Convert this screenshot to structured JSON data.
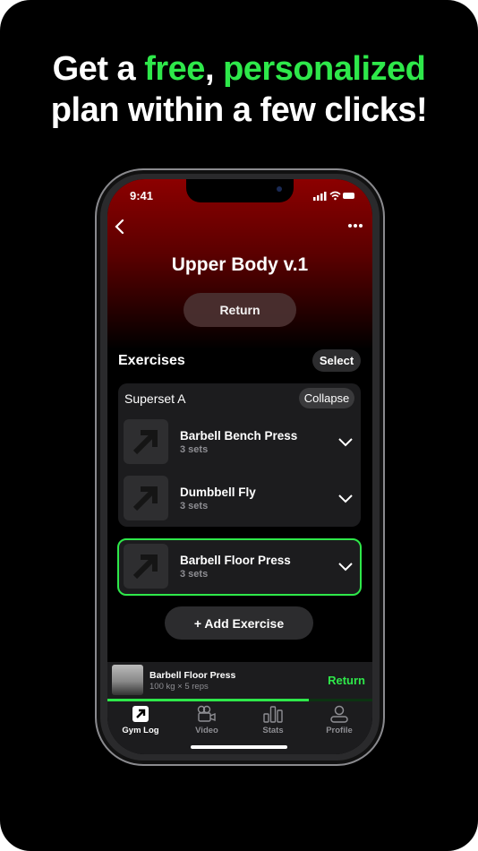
{
  "headline": {
    "line1_a": "Get a ",
    "line1_b": "free",
    ",": ",",
    "line1_c": "personalized",
    "line2": "plan within a few clicks!"
  },
  "colors": {
    "accent": "#2ee84a",
    "hero": "#8c0000"
  },
  "status": {
    "time": "9:41"
  },
  "header": {
    "back_icon": "chevron-left-icon",
    "more_icon": "ellipsis-icon",
    "title": "Upper Body v.1",
    "return_label": "Return"
  },
  "exercises": {
    "title": "Exercises",
    "select_label": "Select",
    "superset": {
      "name": "Superset A",
      "collapse_label": "Collapse",
      "items": [
        {
          "name": "Barbell Bench Press",
          "sets": "3 sets"
        },
        {
          "name": "Dumbbell Fly",
          "sets": "3 sets"
        }
      ]
    },
    "selected": {
      "name": "Barbell Floor Press",
      "sets": "3 sets"
    },
    "add_label": "+ Add Exercise"
  },
  "mini_player": {
    "name": "Barbell Floor Press",
    "detail": "100 kg × 5 reps",
    "action": "Return",
    "progress_percent": 76
  },
  "tabs": [
    {
      "label": "Gym Log",
      "icon": "arrow-up-right-icon",
      "active": true
    },
    {
      "label": "Video",
      "icon": "video-camera-icon"
    },
    {
      "label": "Stats",
      "icon": "bar-chart-icon"
    },
    {
      "label": "Profile",
      "icon": "person-icon"
    }
  ]
}
